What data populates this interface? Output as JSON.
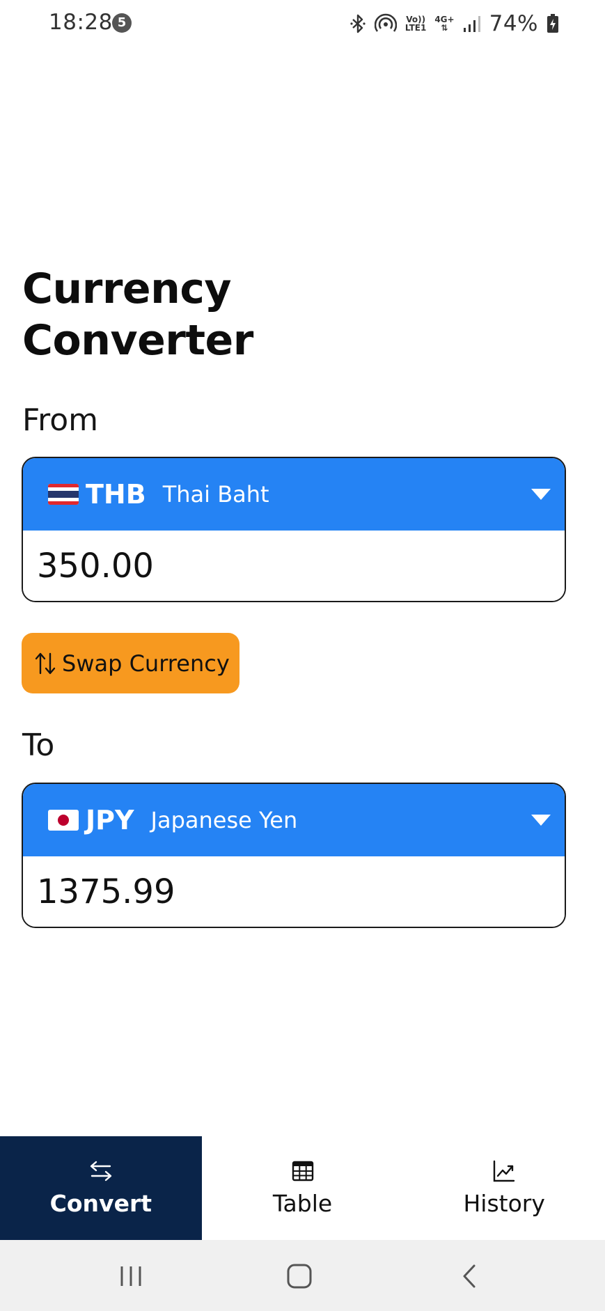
{
  "status_bar": {
    "time": "18:28",
    "notification_count": "5",
    "network_top": "Vo))",
    "network_bottom": "LTE1",
    "data_type": "4G+",
    "battery": "74%"
  },
  "title": "Currency Converter",
  "from": {
    "label": "From",
    "currency_code": "THB",
    "currency_name": "Thai Baht",
    "flag": "thailand-flag",
    "amount": "350.00"
  },
  "swap_button": {
    "label": "Swap Currency",
    "icon": "swap-vertical-arrows-icon"
  },
  "to": {
    "label": "To",
    "currency_code": "JPY",
    "currency_name": "Japanese Yen",
    "flag": "japan-flag",
    "amount": "1375.99"
  },
  "bottom_nav": {
    "tabs": [
      {
        "label": "Convert",
        "icon": "swap-horizontal-arrows-icon",
        "active": true
      },
      {
        "label": "Table",
        "icon": "table-grid-icon",
        "active": false
      },
      {
        "label": "History",
        "icon": "trend-chart-icon",
        "active": false
      }
    ]
  },
  "colors": {
    "primary_blue": "#2583f4",
    "swap_orange": "#f7991f",
    "nav_active": "#0a2449",
    "system_nav_bg": "#f0f0f0"
  }
}
